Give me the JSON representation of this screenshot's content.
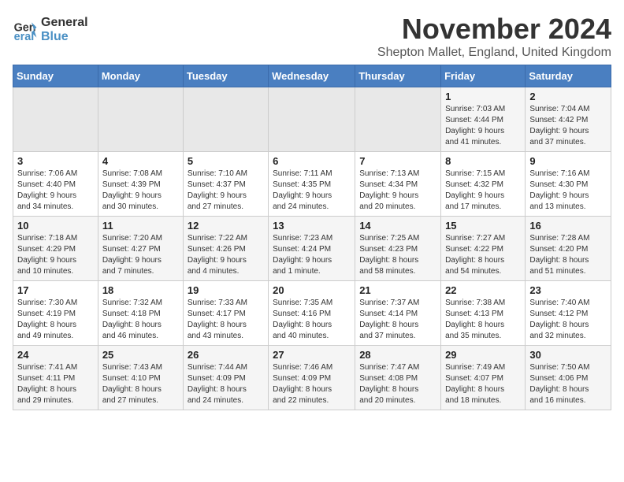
{
  "logo": {
    "line1": "General",
    "line2": "Blue"
  },
  "title": "November 2024",
  "subtitle": "Shepton Mallet, England, United Kingdom",
  "days_of_week": [
    "Sunday",
    "Monday",
    "Tuesday",
    "Wednesday",
    "Thursday",
    "Friday",
    "Saturday"
  ],
  "weeks": [
    [
      {
        "day": "",
        "info": ""
      },
      {
        "day": "",
        "info": ""
      },
      {
        "day": "",
        "info": ""
      },
      {
        "day": "",
        "info": ""
      },
      {
        "day": "",
        "info": ""
      },
      {
        "day": "1",
        "info": "Sunrise: 7:03 AM\nSunset: 4:44 PM\nDaylight: 9 hours\nand 41 minutes."
      },
      {
        "day": "2",
        "info": "Sunrise: 7:04 AM\nSunset: 4:42 PM\nDaylight: 9 hours\nand 37 minutes."
      }
    ],
    [
      {
        "day": "3",
        "info": "Sunrise: 7:06 AM\nSunset: 4:40 PM\nDaylight: 9 hours\nand 34 minutes."
      },
      {
        "day": "4",
        "info": "Sunrise: 7:08 AM\nSunset: 4:39 PM\nDaylight: 9 hours\nand 30 minutes."
      },
      {
        "day": "5",
        "info": "Sunrise: 7:10 AM\nSunset: 4:37 PM\nDaylight: 9 hours\nand 27 minutes."
      },
      {
        "day": "6",
        "info": "Sunrise: 7:11 AM\nSunset: 4:35 PM\nDaylight: 9 hours\nand 24 minutes."
      },
      {
        "day": "7",
        "info": "Sunrise: 7:13 AM\nSunset: 4:34 PM\nDaylight: 9 hours\nand 20 minutes."
      },
      {
        "day": "8",
        "info": "Sunrise: 7:15 AM\nSunset: 4:32 PM\nDaylight: 9 hours\nand 17 minutes."
      },
      {
        "day": "9",
        "info": "Sunrise: 7:16 AM\nSunset: 4:30 PM\nDaylight: 9 hours\nand 13 minutes."
      }
    ],
    [
      {
        "day": "10",
        "info": "Sunrise: 7:18 AM\nSunset: 4:29 PM\nDaylight: 9 hours\nand 10 minutes."
      },
      {
        "day": "11",
        "info": "Sunrise: 7:20 AM\nSunset: 4:27 PM\nDaylight: 9 hours\nand 7 minutes."
      },
      {
        "day": "12",
        "info": "Sunrise: 7:22 AM\nSunset: 4:26 PM\nDaylight: 9 hours\nand 4 minutes."
      },
      {
        "day": "13",
        "info": "Sunrise: 7:23 AM\nSunset: 4:24 PM\nDaylight: 9 hours\nand 1 minute."
      },
      {
        "day": "14",
        "info": "Sunrise: 7:25 AM\nSunset: 4:23 PM\nDaylight: 8 hours\nand 58 minutes."
      },
      {
        "day": "15",
        "info": "Sunrise: 7:27 AM\nSunset: 4:22 PM\nDaylight: 8 hours\nand 54 minutes."
      },
      {
        "day": "16",
        "info": "Sunrise: 7:28 AM\nSunset: 4:20 PM\nDaylight: 8 hours\nand 51 minutes."
      }
    ],
    [
      {
        "day": "17",
        "info": "Sunrise: 7:30 AM\nSunset: 4:19 PM\nDaylight: 8 hours\nand 49 minutes."
      },
      {
        "day": "18",
        "info": "Sunrise: 7:32 AM\nSunset: 4:18 PM\nDaylight: 8 hours\nand 46 minutes."
      },
      {
        "day": "19",
        "info": "Sunrise: 7:33 AM\nSunset: 4:17 PM\nDaylight: 8 hours\nand 43 minutes."
      },
      {
        "day": "20",
        "info": "Sunrise: 7:35 AM\nSunset: 4:16 PM\nDaylight: 8 hours\nand 40 minutes."
      },
      {
        "day": "21",
        "info": "Sunrise: 7:37 AM\nSunset: 4:14 PM\nDaylight: 8 hours\nand 37 minutes."
      },
      {
        "day": "22",
        "info": "Sunrise: 7:38 AM\nSunset: 4:13 PM\nDaylight: 8 hours\nand 35 minutes."
      },
      {
        "day": "23",
        "info": "Sunrise: 7:40 AM\nSunset: 4:12 PM\nDaylight: 8 hours\nand 32 minutes."
      }
    ],
    [
      {
        "day": "24",
        "info": "Sunrise: 7:41 AM\nSunset: 4:11 PM\nDaylight: 8 hours\nand 29 minutes."
      },
      {
        "day": "25",
        "info": "Sunrise: 7:43 AM\nSunset: 4:10 PM\nDaylight: 8 hours\nand 27 minutes."
      },
      {
        "day": "26",
        "info": "Sunrise: 7:44 AM\nSunset: 4:09 PM\nDaylight: 8 hours\nand 24 minutes."
      },
      {
        "day": "27",
        "info": "Sunrise: 7:46 AM\nSunset: 4:09 PM\nDaylight: 8 hours\nand 22 minutes."
      },
      {
        "day": "28",
        "info": "Sunrise: 7:47 AM\nSunset: 4:08 PM\nDaylight: 8 hours\nand 20 minutes."
      },
      {
        "day": "29",
        "info": "Sunrise: 7:49 AM\nSunset: 4:07 PM\nDaylight: 8 hours\nand 18 minutes."
      },
      {
        "day": "30",
        "info": "Sunrise: 7:50 AM\nSunset: 4:06 PM\nDaylight: 8 hours\nand 16 minutes."
      }
    ]
  ]
}
